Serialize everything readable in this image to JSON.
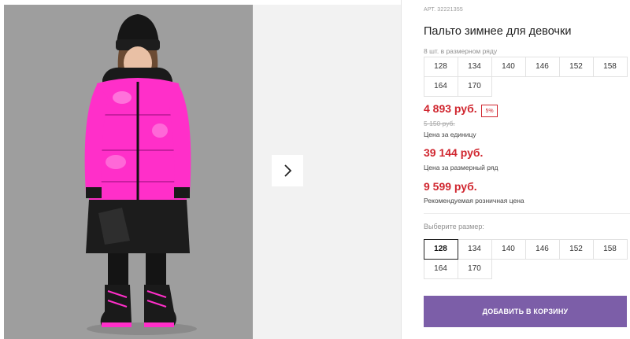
{
  "gallery": {
    "next_icon": "chevron-right-icon",
    "colors": {
      "jacket": "#ff2fc9",
      "background": "#9c9c9c"
    }
  },
  "product": {
    "sku_label": "АРТ.",
    "sku_value": "32221355",
    "title": "Пальто зимнее для девочки",
    "row_note": "8 шт. в размерном ряду",
    "size_row": [
      "128",
      "134",
      "140",
      "146",
      "152",
      "158",
      "164",
      "170"
    ]
  },
  "prices": {
    "main": "4 893 руб.",
    "discount": "5%",
    "old": "5 150 руб.",
    "main_caption": "Цена за единицу",
    "row": "39 144 руб.",
    "row_caption": "Цена за размерный ряд",
    "retail": "9 599 руб.",
    "retail_caption": "Рекомендуемая розничная цена"
  },
  "size_select": {
    "label": "Выберите размер:",
    "options": [
      "128",
      "134",
      "140",
      "146",
      "152",
      "158",
      "164",
      "170"
    ],
    "selected": "128"
  },
  "cart": {
    "button_label": "ДОБАВИТЬ В КОРЗИНУ",
    "color": "#7c5ea8"
  },
  "colors": {
    "price_red": "#d0262f"
  }
}
